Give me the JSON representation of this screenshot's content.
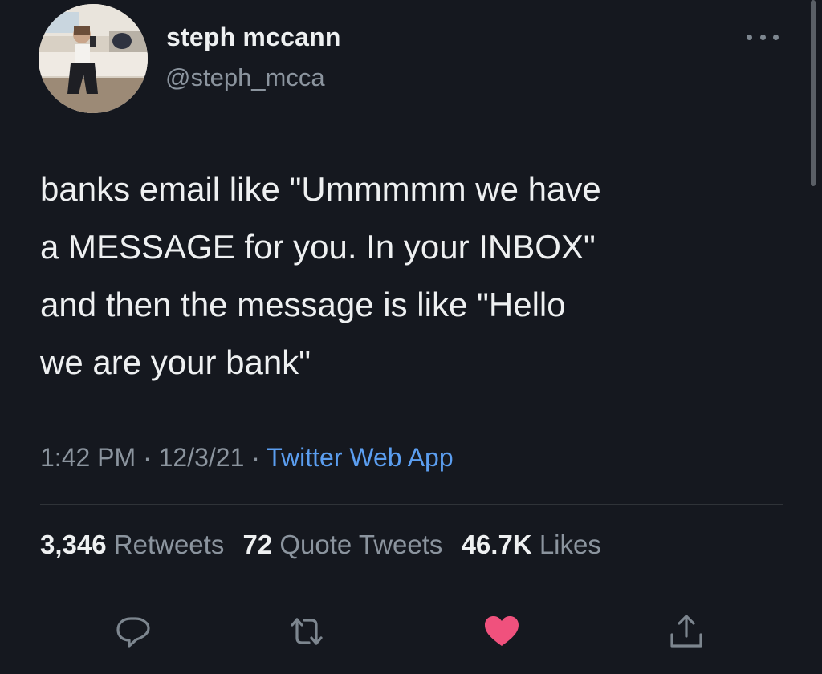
{
  "author": {
    "name": "steph mccann",
    "handle": "@steph_mcca"
  },
  "tweet": {
    "text": "banks email like \"Ummmmm we have\na MESSAGE for you. In your INBOX\"\nand then the message is like \"Hello\nwe are your bank\"",
    "time": "1:42 PM",
    "date": "12/3/21",
    "source": "Twitter Web App"
  },
  "stats": {
    "retweets_count": "3,346",
    "retweets_label": "Retweets",
    "quotes_count": "72",
    "quotes_label": "Quote Tweets",
    "likes_count": "46.7K",
    "likes_label": "Likes"
  },
  "actions": {
    "reply_icon": "reply-icon",
    "retweet_icon": "retweet-icon",
    "like_icon": "heart-icon",
    "like_active": true,
    "share_icon": "share-icon"
  },
  "colors": {
    "background": "#15181f",
    "text": "#eef0f1",
    "muted": "#8b949e",
    "link": "#5b9ef0",
    "like": "#f0517d"
  }
}
